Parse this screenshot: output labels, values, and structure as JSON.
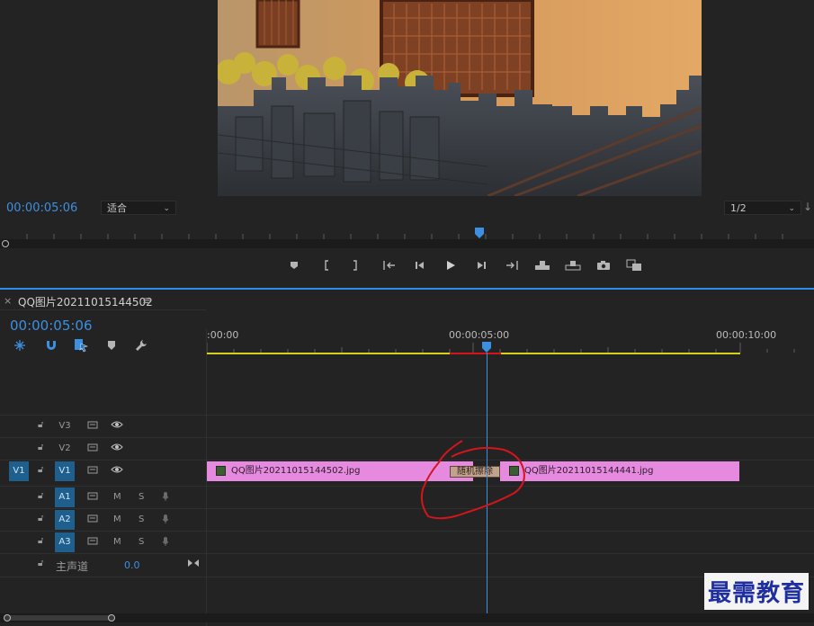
{
  "monitor": {
    "timecode": "00:00:05:06",
    "fit_select": "适合",
    "resolution_select": "1/2",
    "transport": [
      "marker-icon",
      "in-point-icon",
      "out-point-icon",
      "go-to-in-icon",
      "step-back-icon",
      "play-icon",
      "step-forward-icon",
      "go-to-out-icon",
      "insert-icon",
      "overwrite-icon",
      "export-frame-icon",
      "compare-icon"
    ]
  },
  "timeline": {
    "close_glyph": "×",
    "sequence_name": "QQ图片20211015144502",
    "menu_glyph": "≡",
    "timecode": "00:00:05:06",
    "ruler_labels": [
      ":00:00",
      "00:00:05:00",
      "00:00:10:00"
    ],
    "tracks": {
      "v3": {
        "label": "V3"
      },
      "v2": {
        "label": "V2"
      },
      "v1": {
        "source": "V1",
        "label": "V1"
      },
      "a1": {
        "label": "A1",
        "m": "M",
        "s": "S"
      },
      "a2": {
        "label": "A2",
        "m": "M",
        "s": "S"
      },
      "a3": {
        "label": "A3",
        "m": "M",
        "s": "S"
      },
      "master": {
        "label": "主声道",
        "value": "0.0"
      }
    },
    "clips": {
      "clip1": "QQ图片20211015144502.jpg",
      "transition": "随机擦除",
      "clip2": "QQ图片20211015144441.jpg"
    }
  },
  "watermark": "最需教育",
  "colors": {
    "accent": "#2d8ceb",
    "clip": "#e68ae0",
    "timecode": "#3d8fe0",
    "annotation": "#d4151b"
  }
}
